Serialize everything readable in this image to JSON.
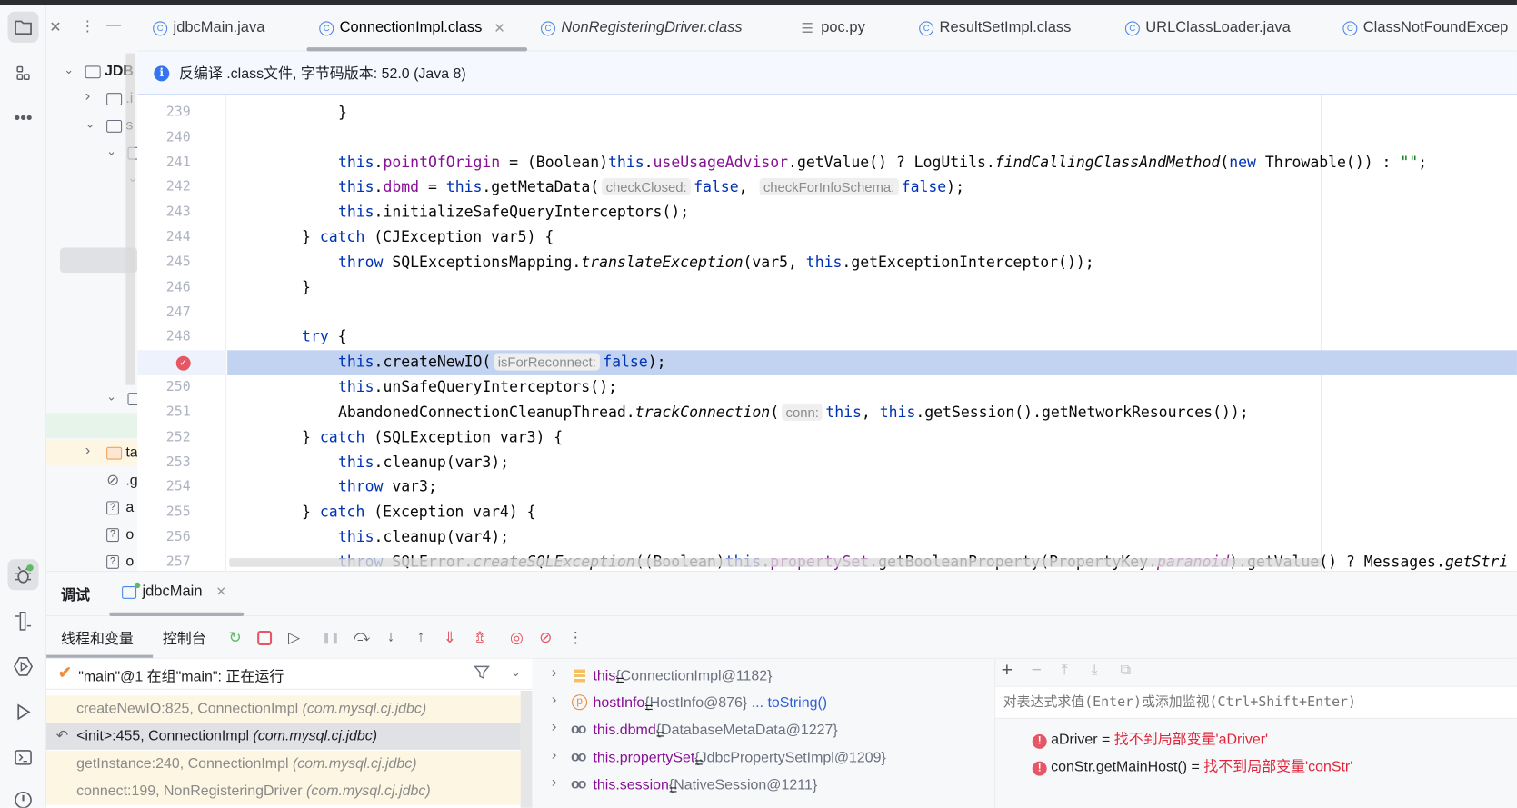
{
  "project_panel": {
    "actions": [
      "close-icon",
      "more-icon",
      "minimize-icon"
    ],
    "tree": [
      {
        "label": "JDB",
        "depth": 0,
        "chevron": "down",
        "icon": "module-folder"
      },
      {
        "label": ".i",
        "depth": 1,
        "chevron": "right",
        "icon": "folder"
      },
      {
        "label": "s",
        "depth": 1,
        "chevron": "down",
        "icon": "folder"
      },
      {
        "label": "",
        "depth": 2,
        "chevron": "down",
        "icon": "folder"
      },
      {
        "label": "",
        "depth": 3,
        "chevron": "down",
        "icon": ""
      },
      {
        "label": "",
        "depth": 2,
        "chevron": "down",
        "icon": "folder"
      },
      {
        "label": "ta",
        "depth": 1,
        "chevron": "right",
        "icon": "excluded-folder"
      },
      {
        "label": ".g",
        "depth": 1,
        "chevron": "",
        "icon": "ignored-file"
      },
      {
        "label": "a",
        "depth": 1,
        "chevron": "",
        "icon": "unknown-file"
      },
      {
        "label": "o",
        "depth": 1,
        "chevron": "",
        "icon": "unknown-file"
      },
      {
        "label": "o",
        "depth": 1,
        "chevron": "",
        "icon": "unknown-file"
      }
    ]
  },
  "tabs": [
    {
      "label": "jdbcMain.java",
      "icon": "class"
    },
    {
      "label": "ConnectionImpl.class",
      "icon": "class",
      "active": true,
      "closable": true
    },
    {
      "label": "NonRegisteringDriver.class",
      "icon": "class",
      "italic": true
    },
    {
      "label": "poc.py",
      "icon": "text"
    },
    {
      "label": "ResultSetImpl.class",
      "icon": "class"
    },
    {
      "label": "URLClassLoader.java",
      "icon": "class"
    },
    {
      "label": "ClassNotFoundExcep",
      "icon": "class"
    }
  ],
  "banner": {
    "text": "反编译 .class文件, 字节码版本: 52.0 (Java 8)"
  },
  "editor": {
    "current_line": 249,
    "lines": [
      {
        "n": 239,
        "i": 12,
        "t": [
          [
            "p",
            "}"
          ]
        ]
      },
      {
        "n": 240,
        "i": 0,
        "t": []
      },
      {
        "n": 241,
        "i": 12,
        "t": [
          [
            "kw",
            "this"
          ],
          [
            "p",
            "."
          ],
          [
            "fld",
            "pointOfOrigin"
          ],
          [
            "p",
            " = (Boolean)"
          ],
          [
            "kw",
            "this"
          ],
          [
            "p",
            "."
          ],
          [
            "fld",
            "useUsageAdvisor"
          ],
          [
            "p",
            ".getValue() ? LogUtils."
          ],
          [
            "it",
            "findCallingClassAndMethod"
          ],
          [
            "p",
            "("
          ],
          [
            "kw",
            "new"
          ],
          [
            "p",
            " Throwable()) : "
          ],
          [
            "str",
            "\"\""
          ],
          [
            "p",
            ";"
          ]
        ]
      },
      {
        "n": 242,
        "i": 12,
        "t": [
          [
            "kw",
            "this"
          ],
          [
            "p",
            "."
          ],
          [
            "fld",
            "dbmd"
          ],
          [
            "p",
            " = "
          ],
          [
            "kw",
            "this"
          ],
          [
            "p",
            ".getMetaData("
          ],
          [
            "hint",
            "checkClosed:"
          ],
          [
            "kw",
            "false"
          ],
          [
            "p",
            ", "
          ],
          [
            "hint",
            "checkForInfoSchema:"
          ],
          [
            "kw",
            "false"
          ],
          [
            "p",
            ");"
          ]
        ]
      },
      {
        "n": 243,
        "i": 12,
        "t": [
          [
            "kw",
            "this"
          ],
          [
            "p",
            ".initializeSafeQueryInterceptors();"
          ]
        ]
      },
      {
        "n": 244,
        "i": 8,
        "t": [
          [
            "p",
            "} "
          ],
          [
            "kw",
            "catch"
          ],
          [
            "p",
            " (CJException var5) {"
          ]
        ]
      },
      {
        "n": 245,
        "i": 12,
        "t": [
          [
            "kw",
            "throw"
          ],
          [
            "p",
            " SQLExceptionsMapping."
          ],
          [
            "it",
            "translateException"
          ],
          [
            "p",
            "(var5, "
          ],
          [
            "kw",
            "this"
          ],
          [
            "p",
            ".getExceptionInterceptor());"
          ]
        ]
      },
      {
        "n": 246,
        "i": 8,
        "t": [
          [
            "p",
            "}"
          ]
        ]
      },
      {
        "n": 247,
        "i": 0,
        "t": []
      },
      {
        "n": 248,
        "i": 8,
        "t": [
          [
            "kw",
            "try"
          ],
          [
            "p",
            " {"
          ]
        ]
      },
      {
        "n": 249,
        "i": 12,
        "t": [
          [
            "kw",
            "this"
          ],
          [
            "p",
            ".createNewIO("
          ],
          [
            "hint",
            "isForReconnect:"
          ],
          [
            "kw",
            "false"
          ],
          [
            "p",
            ");"
          ]
        ]
      },
      {
        "n": 250,
        "i": 12,
        "t": [
          [
            "kw",
            "this"
          ],
          [
            "p",
            ".unSafeQueryInterceptors();"
          ]
        ]
      },
      {
        "n": 251,
        "i": 12,
        "t": [
          [
            "p",
            "AbandonedConnectionCleanupThread."
          ],
          [
            "it",
            "trackConnection"
          ],
          [
            "p",
            "("
          ],
          [
            "hint",
            "conn:"
          ],
          [
            "kw",
            "this"
          ],
          [
            "p",
            ", "
          ],
          [
            "kw",
            "this"
          ],
          [
            "p",
            ".getSession().getNetworkResources());"
          ]
        ]
      },
      {
        "n": 252,
        "i": 8,
        "t": [
          [
            "p",
            "} "
          ],
          [
            "kw",
            "catch"
          ],
          [
            "p",
            " (SQLException var3) {"
          ]
        ]
      },
      {
        "n": 253,
        "i": 12,
        "t": [
          [
            "kw",
            "this"
          ],
          [
            "p",
            ".cleanup(var3);"
          ]
        ]
      },
      {
        "n": 254,
        "i": 12,
        "t": [
          [
            "kw",
            "throw"
          ],
          [
            "p",
            " var3;"
          ]
        ]
      },
      {
        "n": 255,
        "i": 8,
        "t": [
          [
            "p",
            "} "
          ],
          [
            "kw",
            "catch"
          ],
          [
            "p",
            " (Exception var4) {"
          ]
        ]
      },
      {
        "n": 256,
        "i": 12,
        "t": [
          [
            "kw",
            "this"
          ],
          [
            "p",
            ".cleanup(var4);"
          ]
        ]
      },
      {
        "n": 257,
        "i": 12,
        "t": [
          [
            "kw",
            "throw"
          ],
          [
            "p",
            " SQLError."
          ],
          [
            "it",
            "createSQLException"
          ],
          [
            "p",
            "((Boolean)"
          ],
          [
            "kw",
            "this"
          ],
          [
            "p",
            "."
          ],
          [
            "fld",
            "propertySet"
          ],
          [
            "p",
            ".getBooleanProperty(PropertyKey."
          ],
          [
            "itf",
            "paranoid"
          ],
          [
            "p",
            ").getValue() ? Messages."
          ],
          [
            "it",
            "getStri"
          ]
        ]
      }
    ]
  },
  "debug": {
    "title": "调试",
    "session_tab": "jdbcMain",
    "subtabs": [
      "线程和变量",
      "控制台"
    ],
    "toolbar": [
      "rerun-icon",
      "stop-icon",
      "resume-icon",
      "pause-icon",
      "step-over-icon",
      "step-into-icon",
      "step-out-icon",
      "force-step-into-icon",
      "run-to-cursor-icon",
      "view-breakpoints-icon",
      "mute-breakpoints-icon",
      "more-icon"
    ],
    "thread": "\"main\"@1 在组\"main\": 正在运行",
    "frames": [
      {
        "method": "createNewIO:825, ConnectionImpl",
        "pkg": "(com.mysql.cj.jdbc)"
      },
      {
        "method": "<init>:455, ConnectionImpl",
        "pkg": "(com.mysql.cj.jdbc)",
        "selected": true
      },
      {
        "method": "getInstance:240, ConnectionImpl",
        "pkg": "(com.mysql.cj.jdbc)"
      },
      {
        "method": "connect:199, NonRegisteringDriver",
        "pkg": "(com.mysql.cj.jdbc)"
      }
    ],
    "variables": [
      {
        "name": "this",
        "value": "{ConnectionImpl@1182}",
        "icon": "object"
      },
      {
        "name": "hostInfo",
        "value": "{HostInfo@876}",
        "link": "... toString()",
        "icon": "protected-field"
      },
      {
        "name": "this.dbmd",
        "value": "{DatabaseMetaData@1227}",
        "icon": "watch"
      },
      {
        "name": "this.propertySet",
        "value": "{JdbcPropertySetImpl@1209}",
        "icon": "watch"
      },
      {
        "name": "this.session",
        "value": "{NativeSession@1211}",
        "icon": "watch"
      }
    ],
    "watch_placeholder": "对表达式求值(Enter)或添加监视(Ctrl+Shift+Enter)",
    "watches": [
      {
        "name": "aDriver",
        "value": "找不到局部变量'aDriver'"
      },
      {
        "name": "conStr.getMainHost()",
        "value": "找不到局部变量'conStr'"
      }
    ]
  },
  "colors": {
    "keyword": "#0033b3",
    "field": "#871094",
    "string": "#067d17",
    "error": "#e55765",
    "current_line": "#c2d3f1",
    "frame_bg": "#fdf6e3"
  }
}
